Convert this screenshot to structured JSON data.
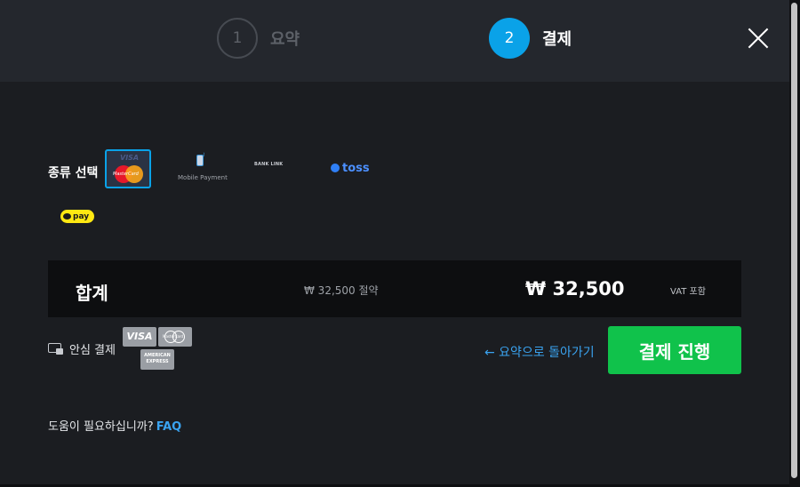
{
  "steps": [
    {
      "number": "1",
      "label": "요약",
      "state": "inactive"
    },
    {
      "number": "2",
      "label": "결제",
      "state": "active"
    }
  ],
  "payment": {
    "type_label": "종류 선택",
    "methods": [
      {
        "id": "card",
        "name": "Visa / MasterCard",
        "visa_text": "VISA",
        "mc_text": "MasterCard",
        "selected": true
      },
      {
        "id": "mobile",
        "caption": "Mobile Payment",
        "selected": false
      },
      {
        "id": "bank",
        "caption": "BANK LINK",
        "selected": false
      },
      {
        "id": "toss",
        "caption": "toss",
        "selected": false
      },
      {
        "id": "kakaopay",
        "caption": "pay",
        "selected": false
      }
    ]
  },
  "summary": {
    "total_label": "합계",
    "discount": "₩ 32,500 절약",
    "total_amount": "₩ 32,500",
    "vat_note": "VAT 포함"
  },
  "secure": {
    "label": "안심 결제",
    "brands": {
      "visa": "VISA",
      "mastercard": "MasterCard",
      "amex": "AMERICAN EXPRESS"
    }
  },
  "actions": {
    "back_label": "← 요약으로 돌아가기",
    "pay_label": "결제 진행"
  },
  "help": {
    "text": "도움이 필요하십니까?",
    "faq": "FAQ"
  },
  "colors": {
    "accent": "#0aa2e8",
    "cta": "#10c24b",
    "link": "#3aa3f0",
    "background": "#1b1d21",
    "header": "#24272d"
  }
}
